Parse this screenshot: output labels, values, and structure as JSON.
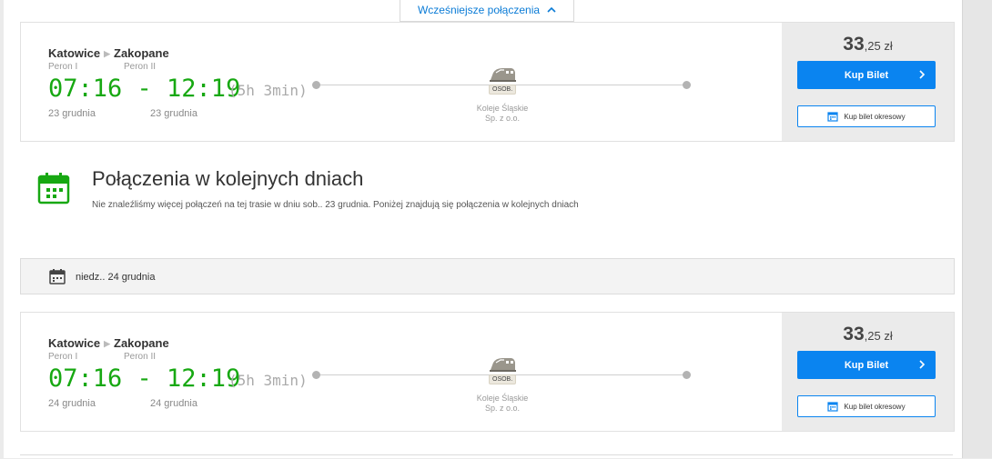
{
  "top": {
    "earlier_label": "Wcześniejsze połączenia"
  },
  "connections": [
    {
      "from_station": "Katowice",
      "to_station": "Zakopane",
      "from_platform": "Peron I",
      "to_platform": "Peron II",
      "times": "07:16 - 12:19",
      "duration": "(5h 3min)",
      "from_date": "23 grudnia",
      "to_date": "23 grudnia",
      "train_type": "OSOB.",
      "operator_line1": "Koleje Śląskie",
      "operator_line2": "Sp. z o.o.",
      "price_main": "33",
      "price_rest": ",25 zł",
      "buy_label": "Kup Bilet",
      "season_label": "Kup bilet okresowy"
    },
    {
      "from_station": "Katowice",
      "to_station": "Zakopane",
      "from_platform": "Peron I",
      "to_platform": "Peron II",
      "times": "07:16 - 12:19",
      "duration": "(5h 3min)",
      "from_date": "24 grudnia",
      "to_date": "24 grudnia",
      "train_type": "OSOB.",
      "operator_line1": "Koleje Śląskie",
      "operator_line2": "Sp. z o.o.",
      "price_main": "33",
      "price_rest": ",25 zł",
      "buy_label": "Kup Bilet",
      "season_label": "Kup bilet okresowy"
    }
  ],
  "next_days": {
    "title": "Połączenia w kolejnych dniach",
    "description": "Nie znaleźliśmy więcej połączeń na tej trasie w dniu sob.. 23 grudnia. Poniżej znajdują się połączenia w kolejnych dniach"
  },
  "date_bar": {
    "label": "niedz.. 24 grudnia"
  },
  "colors": {
    "accent": "#0a84f0",
    "time_green": "#17a812",
    "icon_green": "#17a812"
  },
  "icons": [
    "chevron-up-icon",
    "train-icon",
    "chevron-right-icon",
    "calendar-icon"
  ]
}
